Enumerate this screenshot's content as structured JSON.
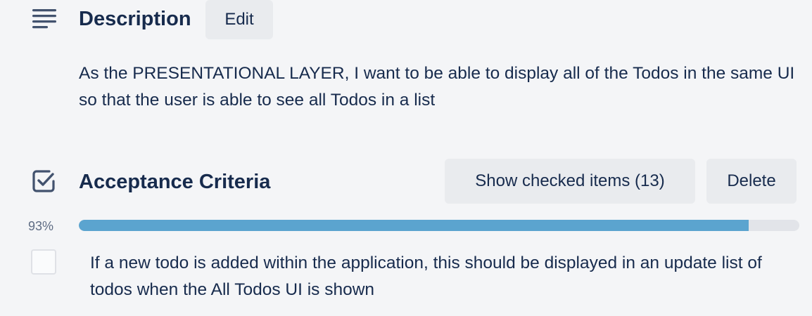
{
  "description": {
    "title": "Description",
    "edit_label": "Edit",
    "text": "As the PRESENTATIONAL LAYER, I want to be able to display all of the Todos in the same UI so that the user is able to see all Todos in a list"
  },
  "checklist": {
    "title": "Acceptance Criteria",
    "show_checked_label": "Show checked items (13)",
    "delete_label": "Delete",
    "progress_percent_label": "93%",
    "progress_value": 93,
    "items": [
      {
        "text": "If a new todo is added within the application, this should be displayed in an update list of todos when the All Todos UI is shown",
        "checked": false
      }
    ]
  },
  "colors": {
    "background": "#f4f5f7",
    "text": "#172b4d",
    "button_bg": "#e9ebee",
    "progress_fill": "#5ba4cf",
    "progress_track": "#e2e4e9"
  },
  "icons": {
    "description": "description-lines-icon",
    "checklist": "checkbox-checked-icon"
  }
}
